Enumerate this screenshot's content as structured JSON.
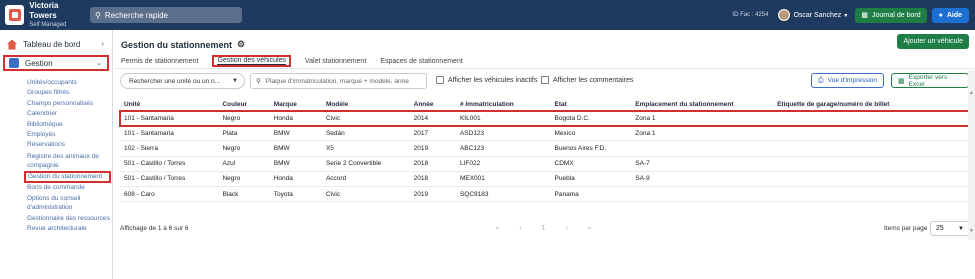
{
  "brand": {
    "name": "Victoria Towers",
    "subtitle": "Self Managed"
  },
  "search": {
    "placeholder": "Recherche rapide"
  },
  "header": {
    "id_fac": "ID Fac : 4254",
    "user": "Oscar Sanchez",
    "journal_button": "Journal de bord",
    "help_button": "Aide"
  },
  "sidebar": {
    "dashboard": "Tableau de bord",
    "gestion": "Gestion",
    "items": [
      "Unités/occupants",
      "Groupes filtrés",
      "Champs personnalisés",
      "Calendrier",
      "Bibliothèque",
      "Employés",
      "Réservations",
      "Registre des animaux de compagnie",
      "Gestion du stationnement",
      "Bons de commande",
      "Options du conseil d'administration",
      "Gestionnaire des ressources",
      "Revue architecturale"
    ]
  },
  "page": {
    "title": "Gestion du stationnement",
    "add_button": "Ajouter un véhicule",
    "tabs": [
      "Permis de stationnement",
      "Gestion des véhicules",
      "Valet stationnement",
      "Espaces de stationnement"
    ]
  },
  "toolbar": {
    "unit_select": "Rechercher une unité ou un n...",
    "vehicle_search": "Plaque d'immatriculation, marque + modèle, anne",
    "inactive_checkbox": "Afficher les véhicules inactifs",
    "comments_checkbox": "Afficher les commentaires",
    "print_button": "Vue d'impression",
    "excel_button": "Exporter vers Excel"
  },
  "table": {
    "columns": [
      "Unité",
      "Couleur",
      "Marque",
      "Modèle",
      "Année",
      "# Immatriculation",
      "État",
      "Emplacement du stationnement",
      "Étiquette de garage/numéro de billet"
    ],
    "rows": [
      [
        "101 - Santamaria",
        "Negro",
        "Honda",
        "Civic",
        "2014",
        "KIL001",
        "Bogota D.C.",
        "Zona 1",
        ""
      ],
      [
        "101 - Santamaria",
        "Plata",
        "BMW",
        "Sedán",
        "2017",
        "ASD123",
        "Mexico",
        "Zona 1",
        ""
      ],
      [
        "102 - Sierra",
        "Negro",
        "BMW",
        "X5",
        "2019",
        "ABC123",
        "Buenos Aires F.D.",
        "",
        ""
      ],
      [
        "501 - Castillo / Torres",
        "Azul",
        "BMW",
        "Serie 2 Convertible",
        "2018",
        "LIF022",
        "CDMX",
        "SA-7",
        ""
      ],
      [
        "501 - Castillo / Torres",
        "Negro",
        "Honda",
        "Accord",
        "2018",
        "MEX001",
        "Puebla",
        "SA-9",
        ""
      ],
      [
        "608 - Caro",
        "Black",
        "Toyota",
        "Civic",
        "2019",
        "SQC9183",
        "Panama",
        "",
        ""
      ]
    ]
  },
  "footer": {
    "count": "Affichage de 1 à 6 sur 6",
    "pager": [
      "«",
      "‹",
      "1",
      "›",
      "»"
    ],
    "per_page_label": "Items par page",
    "per_page_value": "25"
  }
}
